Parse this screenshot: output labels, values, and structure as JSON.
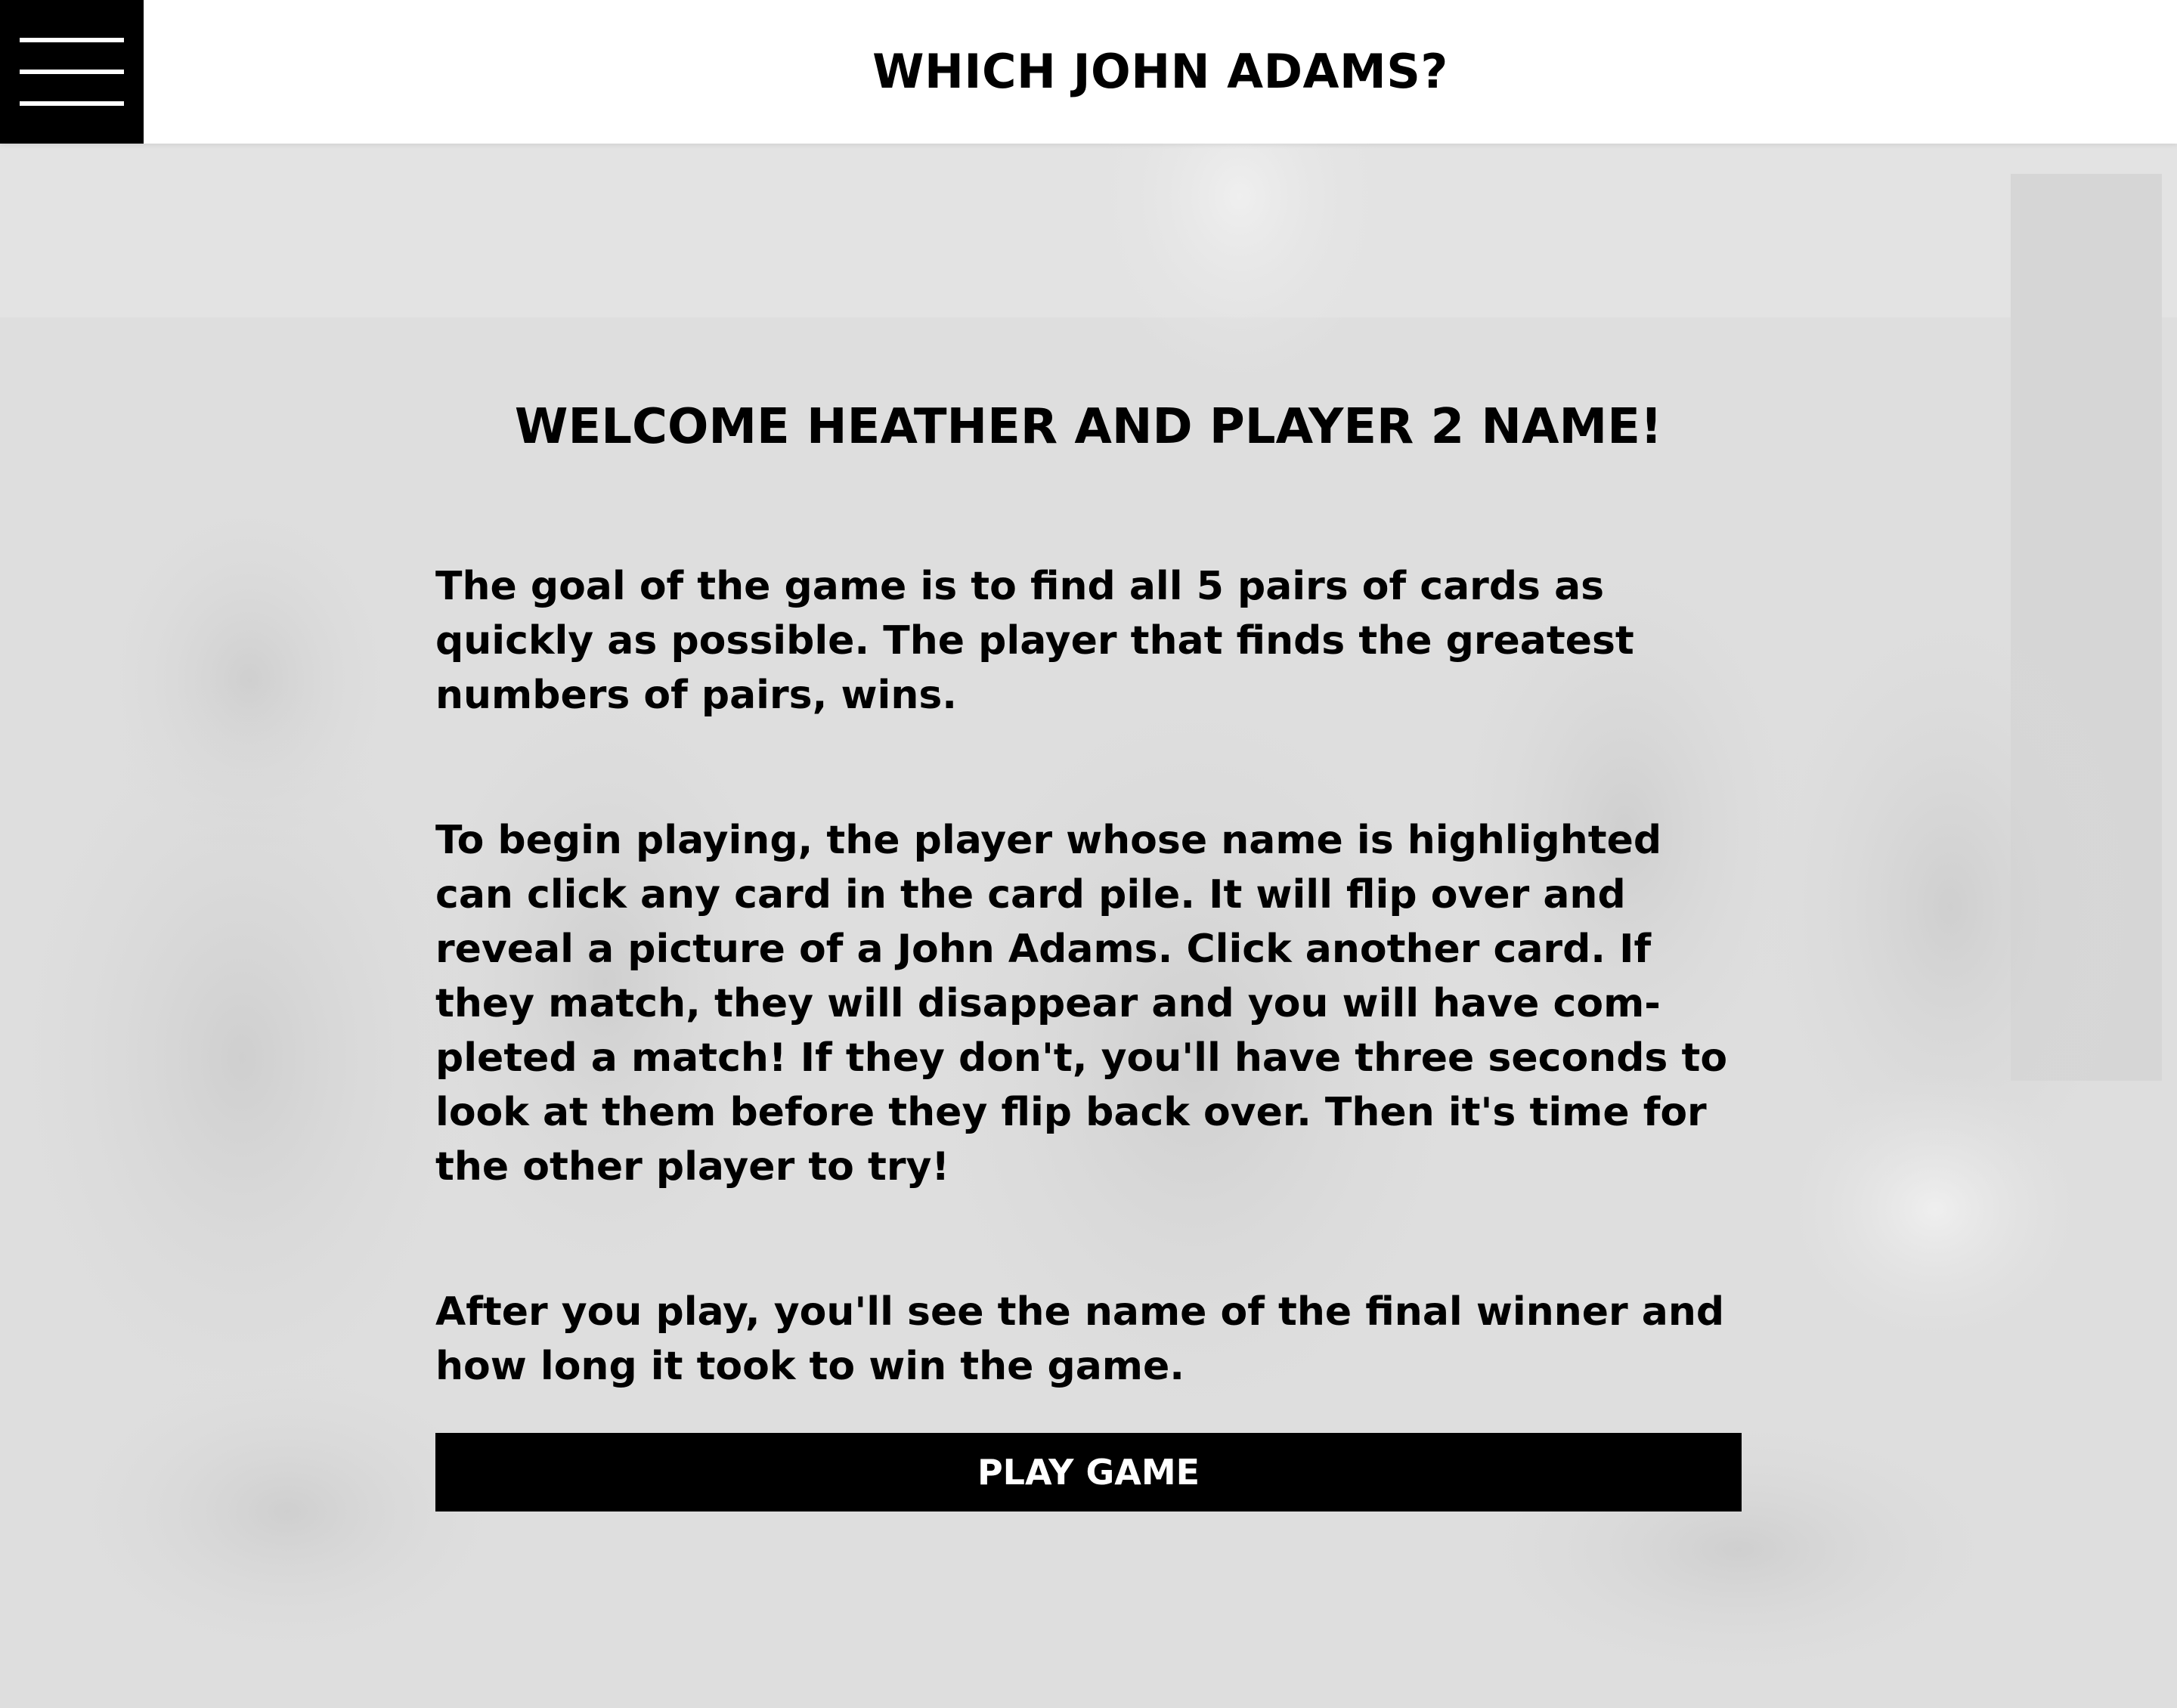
{
  "header": {
    "title": "WHICH JOHN ADAMS?",
    "menu_icon": "hamburger-menu-icon"
  },
  "main": {
    "welcome": "WELCOME HEATHER AND PLAYER 2 NAME!",
    "paragraphs": [
      "The goal of the game is to find all 5 pairs of cards as quickly as possible. The player that finds the greatest numbers of pairs, wins.",
      "To begin playing, the player whose name is highlighted can click any card in the card pile. It will flip over and reveal a picture of a John Adams. Click another card. If they match, they will disappear and you will have com-pleted a match! If they don't, you'll have three seconds to look at them before they flip back over. Then it's time for the other player to try!",
      "After you play, you'll see the name of the final winner and how long it took to win the game."
    ],
    "play_button": "PLAY GAME"
  },
  "colors": {
    "header_bg": "#ffffff",
    "menu_bg": "#000000",
    "page_bg": "#dcdcdc",
    "button_bg": "#000000",
    "button_text": "#ffffff",
    "text": "#000000"
  }
}
